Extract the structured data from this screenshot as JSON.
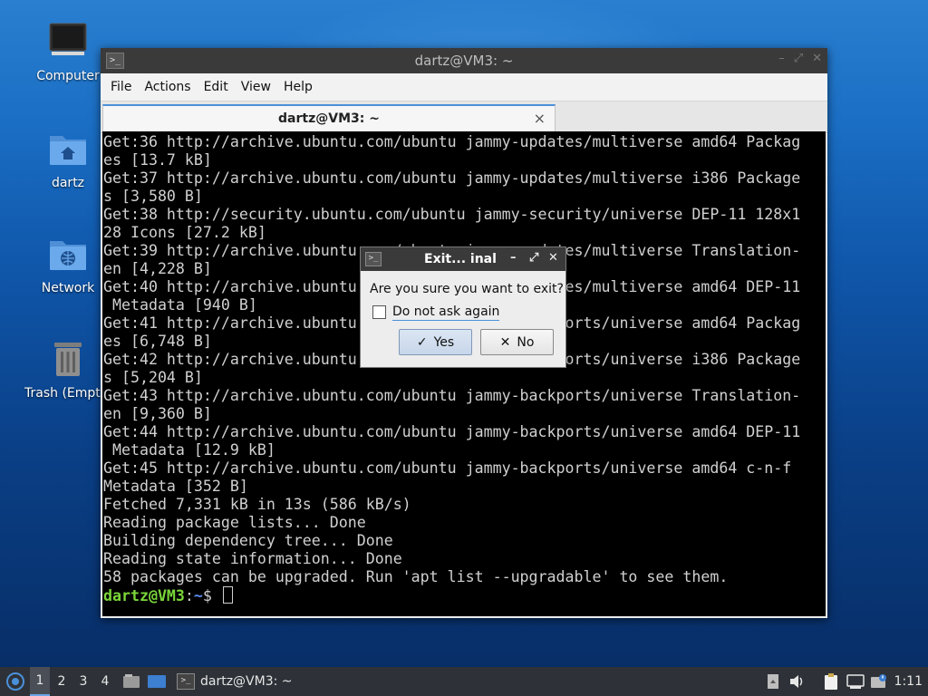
{
  "desktop": {
    "icons": [
      {
        "label": "Computer",
        "icon": "monitor-icon"
      },
      {
        "label": "dartz",
        "icon": "home-folder-icon"
      },
      {
        "label": "Network",
        "icon": "network-folder-icon"
      },
      {
        "label": "Trash (Empty)",
        "icon": "trash-icon"
      }
    ]
  },
  "terminal": {
    "window_title": "dartz@VM3: ~",
    "menu": [
      "File",
      "Actions",
      "Edit",
      "View",
      "Help"
    ],
    "tab_label": "dartz@VM3: ~",
    "tab_close": "×",
    "lines": [
      "Get:36 http://archive.ubuntu.com/ubuntu jammy-updates/multiverse amd64 Packag",
      "es [13.7 kB]",
      "Get:37 http://archive.ubuntu.com/ubuntu jammy-updates/multiverse i386 Package",
      "s [3,580 B]",
      "Get:38 http://security.ubuntu.com/ubuntu jammy-security/universe DEP-11 128x1",
      "28 Icons [27.2 kB]",
      "Get:39 http://archive.ubuntu.com/ubuntu jammy-updates/multiverse Translation-",
      "en [4,228 B]",
      "Get:40 http://archive.ubuntu.com/ubuntu jammy-updates/multiverse amd64 DEP-11",
      " Metadata [940 B]",
      "Get:41 http://archive.ubuntu.com/ubuntu jammy-backports/universe amd64 Packag",
      "es [6,748 B]",
      "Get:42 http://archive.ubuntu.com/ubuntu jammy-backports/universe i386 Package",
      "s [5,204 B]",
      "Get:43 http://archive.ubuntu.com/ubuntu jammy-backports/universe Translation-",
      "en [9,360 B]",
      "Get:44 http://archive.ubuntu.com/ubuntu jammy-backports/universe amd64 DEP-11",
      " Metadata [12.9 kB]",
      "Get:45 http://archive.ubuntu.com/ubuntu jammy-backports/universe amd64 c-n-f",
      "Metadata [352 B]",
      "Fetched 7,331 kB in 13s (586 kB/s)",
      "Reading package lists... Done",
      "Building dependency tree... Done",
      "Reading state information... Done",
      "58 packages can be upgraded. Run 'apt list --upgradable' to see them."
    ],
    "prompt": {
      "user_host": "dartz@VM3",
      "sep": ":",
      "path": "~",
      "symbol": "$ "
    }
  },
  "dialog": {
    "title": "Exit... inal",
    "question": "Are you sure you want to exit?",
    "checkbox_label": "Do not ask again",
    "checkbox_checked": false,
    "yes_label": "Yes",
    "no_label": "No"
  },
  "taskbar": {
    "workspaces": [
      "1",
      "2",
      "3",
      "4"
    ],
    "active_workspace": "1",
    "task_label": "dartz@VM3: ~",
    "clock": "1:11"
  }
}
